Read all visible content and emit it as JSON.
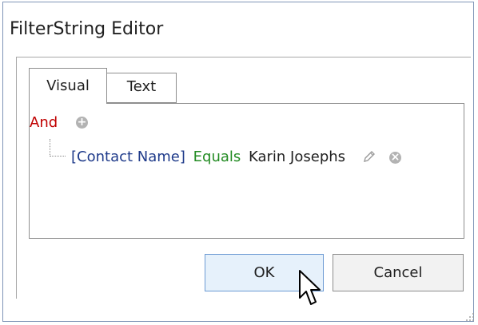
{
  "dialog": {
    "title": "FilterString Editor"
  },
  "tabs": [
    {
      "label": "Visual",
      "active": true
    },
    {
      "label": "Text",
      "active": false
    }
  ],
  "filter": {
    "group_operator": "And",
    "condition": {
      "field": "[Contact Name]",
      "operator": "Equals",
      "value": "Karin Josephs"
    }
  },
  "buttons": {
    "ok_label": "OK",
    "cancel_label": "Cancel"
  },
  "colors": {
    "group_operator": "#c00000",
    "field": "#1e3a8a",
    "operator": "#228b22",
    "ok_button_border": "#6d9bd4",
    "ok_button_bg": "#e6f1fb"
  },
  "icons": {
    "add": "plus-circle-icon",
    "edit": "pencil-icon",
    "remove": "x-circle-icon"
  }
}
